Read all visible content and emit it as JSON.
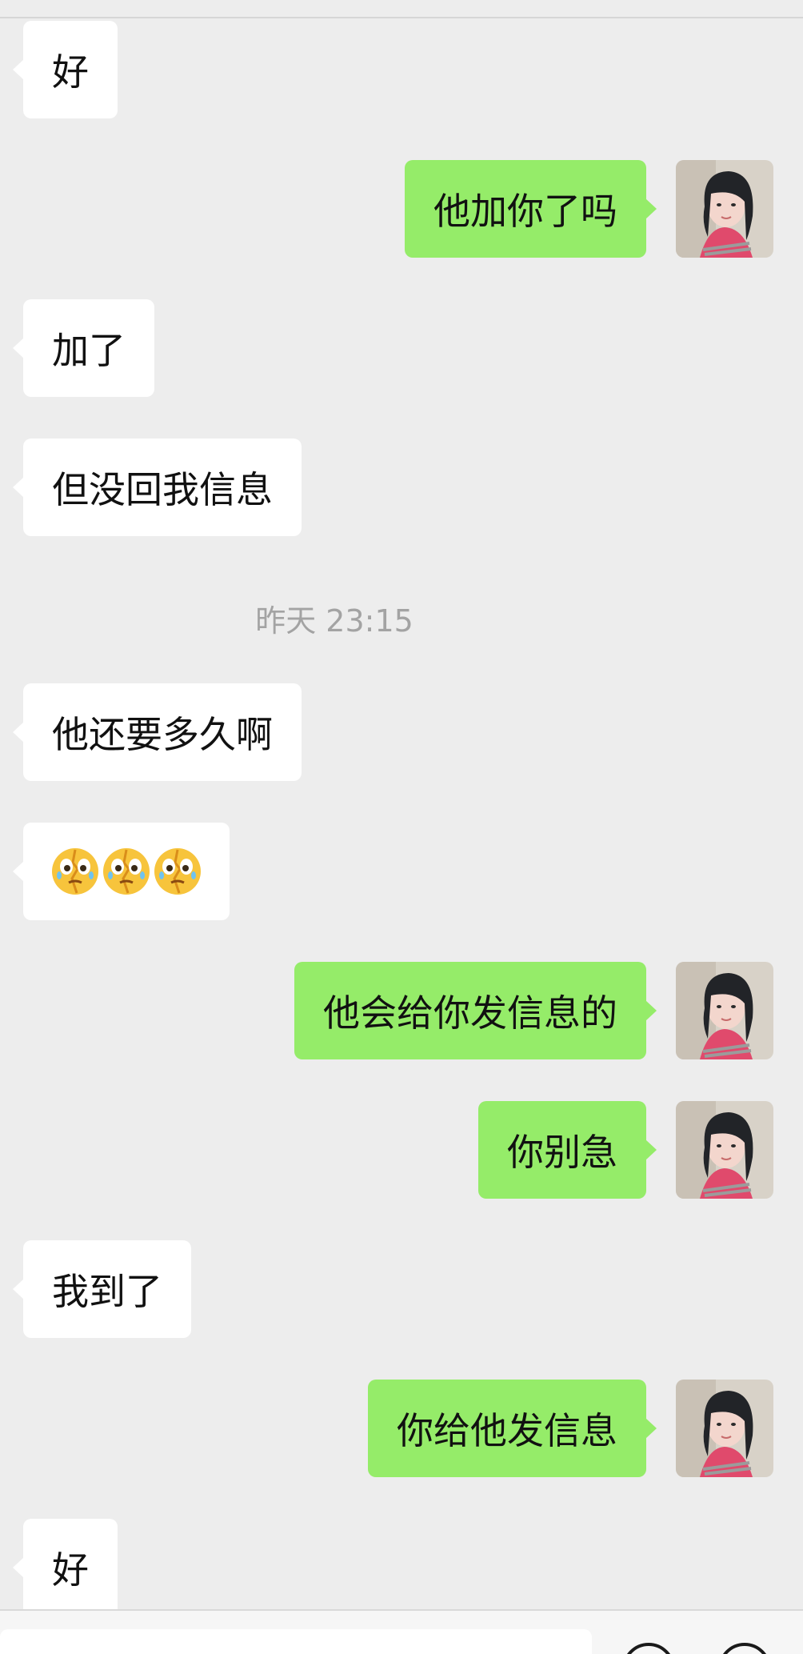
{
  "messages": [
    {
      "side": "in",
      "text": "好"
    },
    {
      "side": "out",
      "text": "他加你了吗"
    },
    {
      "side": "in",
      "text": "加了"
    },
    {
      "side": "in",
      "text": "但没回我信息"
    },
    {
      "side": "in",
      "text": "他还要多久啊"
    },
    {
      "side": "in",
      "emoji": "face-with-tears-emoji",
      "count": 3
    },
    {
      "side": "out",
      "text": "他会给你发信息的"
    },
    {
      "side": "out",
      "text": "你别急"
    },
    {
      "side": "in",
      "text": "我到了"
    },
    {
      "side": "out",
      "text": "你给他发信息"
    },
    {
      "side": "in",
      "text": "好"
    }
  ],
  "timestamp": "昨天 23:15",
  "colors": {
    "background": "#ededed",
    "incoming_bubble": "#ffffff",
    "outgoing_bubble": "#95ec69",
    "timestamp_text": "#a3a3a3"
  },
  "icons": {
    "emoji": "face-with-tears-emoji",
    "avatar": "user-avatar",
    "input_buttons": [
      "voice-icon",
      "emoji-icon"
    ]
  }
}
